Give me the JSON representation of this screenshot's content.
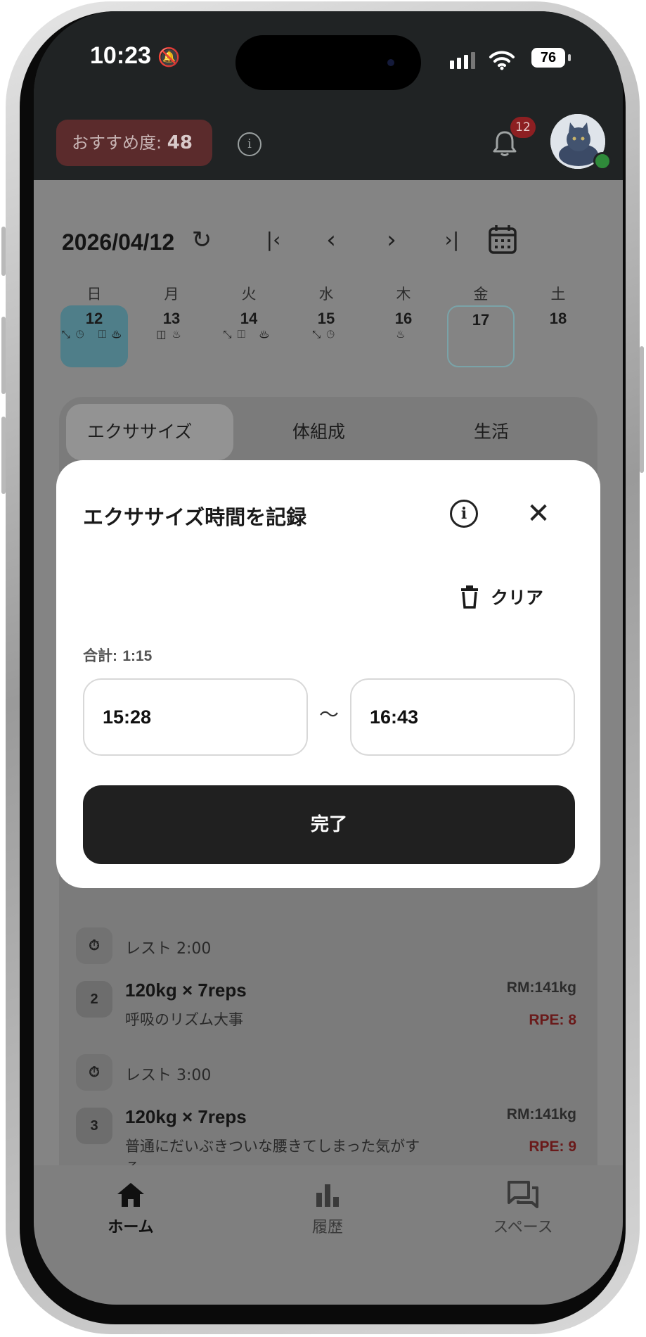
{
  "status_bar": {
    "time": "10:23",
    "battery": "76"
  },
  "header": {
    "recommend_label": "おすすめ度:",
    "recommend_value": "48",
    "notification_count": "12"
  },
  "calendar": {
    "date": "2026/04/12",
    "weekdays": [
      "日",
      "月",
      "火",
      "水",
      "木",
      "金",
      "土"
    ],
    "days": [
      {
        "num": "12",
        "icons": "⤡◷ ◫♨",
        "selected": true
      },
      {
        "num": "13",
        "icons": "◫♨"
      },
      {
        "num": "14",
        "icons": "⤡◫ ♨"
      },
      {
        "num": "15",
        "icons": "⤡◷"
      },
      {
        "num": "16",
        "icons": "♨"
      },
      {
        "num": "17",
        "icons": "",
        "today": true
      },
      {
        "num": "18",
        "icons": ""
      }
    ]
  },
  "tabs": [
    "エクササイズ",
    "体組成",
    "生活"
  ],
  "sets": [
    {
      "rest": "レスト 2:00"
    },
    {
      "no": "2",
      "main": "120kg × 7reps",
      "memo": "呼吸のリズム大事",
      "rm": "RM:141kg",
      "rpe": "RPE: 8"
    },
    {
      "rest": "レスト 3:00"
    },
    {
      "no": "3",
      "main": "120kg × 7reps",
      "memo": "普通にだいぶきついな腰きてしまった気がする",
      "rm": "RM:141kg",
      "rpe": "RPE: 9"
    }
  ],
  "bottom_nav": [
    "ホーム",
    "履歴",
    "スペース"
  ],
  "modal": {
    "title": "エクササイズ時間を記録",
    "clear": "クリア",
    "total_label": "合計:",
    "total_value": "1:15",
    "start": "15:28",
    "tilde": "～",
    "end": "16:43",
    "done": "完了"
  },
  "icons": [
    "info-icon",
    "bell-icon",
    "avatar-cat",
    "refresh-icon",
    "first-page-icon",
    "prev-icon",
    "next-icon",
    "last-page-icon",
    "calendar-icon",
    "timer-icon",
    "home-icon",
    "bar-chart-icon",
    "chat-icon",
    "close-icon",
    "trash-icon"
  ]
}
